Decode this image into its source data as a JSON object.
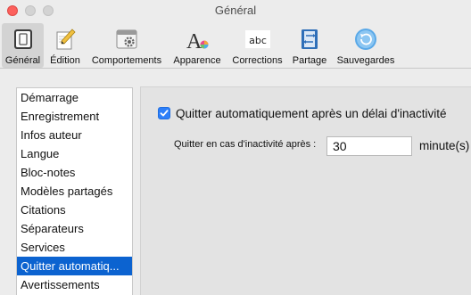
{
  "window": {
    "title": "Général"
  },
  "toolbar": {
    "items": [
      {
        "label": "Général",
        "icon": "general-icon",
        "selected": true
      },
      {
        "label": "Édition",
        "icon": "pencil-icon"
      },
      {
        "label": "Comportements",
        "icon": "behaviors-gear-icon"
      },
      {
        "label": "Apparence",
        "icon": "font-color-icon"
      },
      {
        "label": "Corrections",
        "icon": "abc-icon"
      },
      {
        "label": "Partage",
        "icon": "share-icon"
      },
      {
        "label": "Sauvegardes",
        "icon": "backup-icon"
      }
    ]
  },
  "sidebar": {
    "items": [
      {
        "label": "Démarrage"
      },
      {
        "label": "Enregistrement"
      },
      {
        "label": "Infos auteur"
      },
      {
        "label": "Langue"
      },
      {
        "label": "Bloc-notes"
      },
      {
        "label": "Modèles partagés"
      },
      {
        "label": "Citations"
      },
      {
        "label": "Séparateurs"
      },
      {
        "label": "Services"
      },
      {
        "label": "Quitter automatiq...",
        "selected": true
      },
      {
        "label": "Avertissements"
      }
    ]
  },
  "panel": {
    "auto_quit_checkbox_label": "Quitter automatiquement après un délai d'inactivité",
    "auto_quit_checked": true,
    "inactivity_label": "Quitter en cas d'inactivité après :",
    "inactivity_value": "30",
    "inactivity_unit": "minute(s)"
  },
  "colors": {
    "selection": "#0c63d0",
    "checkbox": "#2d7ff9",
    "close_button": "#fc605c"
  }
}
